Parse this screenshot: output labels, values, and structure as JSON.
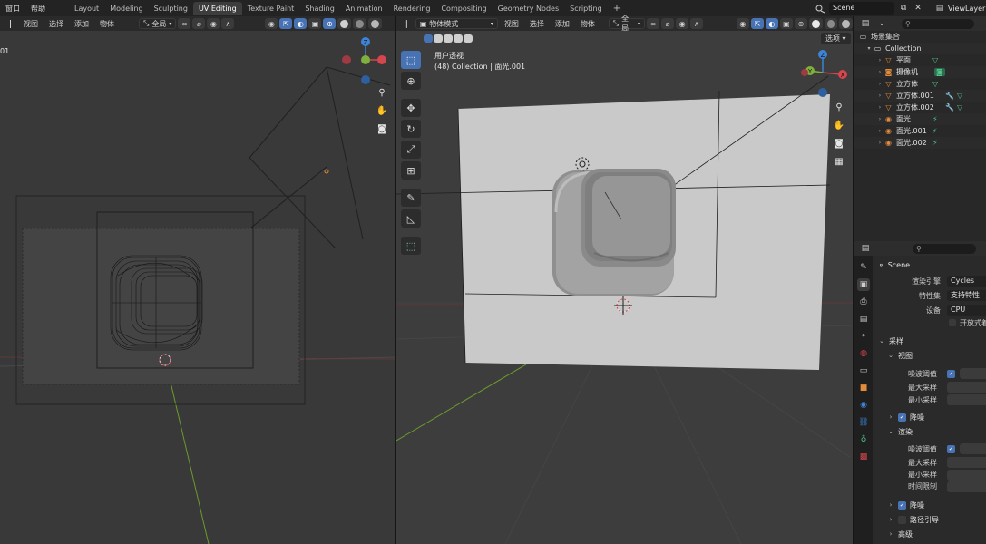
{
  "top_menu": {
    "items": [
      "窗口",
      "帮助"
    ],
    "workspace_tabs": [
      "Layout",
      "Modeling",
      "Sculpting",
      "UV Editing",
      "Texture Paint",
      "Shading",
      "Animation",
      "Rendering",
      "Compositing",
      "Geometry Nodes",
      "Scripting"
    ],
    "active_tab": "UV Editing",
    "add_tab": "+",
    "scene_name": "Scene",
    "view_layer": "ViewLayer"
  },
  "left_viewport": {
    "header_items": [
      "视图",
      "选择",
      "添加",
      "物体"
    ],
    "transform_orientation": "全局",
    "corner_label": "01"
  },
  "right_viewport": {
    "mode": "物体模式",
    "header_items": [
      "视图",
      "选择",
      "添加",
      "物体"
    ],
    "transform_orientation": "全局",
    "view_name": "用户透视",
    "collection_info": "(48) Collection | 面光.001",
    "options_label": "选项",
    "gizmo_axes": {
      "x": "X",
      "y": "Y",
      "z": "Z"
    }
  },
  "outliner": {
    "root": "场景集合",
    "collection": "Collection",
    "items": [
      {
        "name": "平面",
        "icon": "mesh-icon",
        "icon_color": "#e38b3c"
      },
      {
        "name": "摄像机",
        "icon": "camera-icon",
        "icon_color": "#e38b3c"
      },
      {
        "name": "立方体",
        "icon": "mesh-icon",
        "icon_color": "#e38b3c"
      },
      {
        "name": "立方体.001",
        "icon": "mesh-icon",
        "icon_color": "#e38b3c"
      },
      {
        "name": "立方体.002",
        "icon": "mesh-icon",
        "icon_color": "#e38b3c"
      },
      {
        "name": "面光",
        "icon": "light-icon",
        "icon_color": "#e38b3c"
      },
      {
        "name": "面光.001",
        "icon": "light-icon",
        "icon_color": "#e38b3c"
      },
      {
        "name": "面光.002",
        "icon": "light-icon",
        "icon_color": "#e38b3c"
      }
    ]
  },
  "properties": {
    "scene_label": "Scene",
    "render_engine_label": "渲染引擎",
    "render_engine": "Cycles",
    "feature_set_label": "特性集",
    "feature_set": "支持特性",
    "device_label": "设备",
    "device": "CPU",
    "open_shading_label": "开放式着色",
    "sampling_label": "采样",
    "viewport_label": "视图",
    "noise_threshold_label": "噪波阈值",
    "max_samples_label": "最大采样",
    "min_samples_label": "最小采样",
    "denoise_label": "降噪",
    "render_label": "渲染",
    "time_limit_label": "时间限制",
    "path_guiding_label": "路径引导",
    "advanced_label": "高级"
  },
  "colors": {
    "accent_blue": "#4772b3",
    "axis_x": "#d6464e",
    "axis_y": "#7fb03c",
    "axis_z": "#3d83d6",
    "object_orange": "#e38b3c",
    "data_green": "#51c28a"
  }
}
